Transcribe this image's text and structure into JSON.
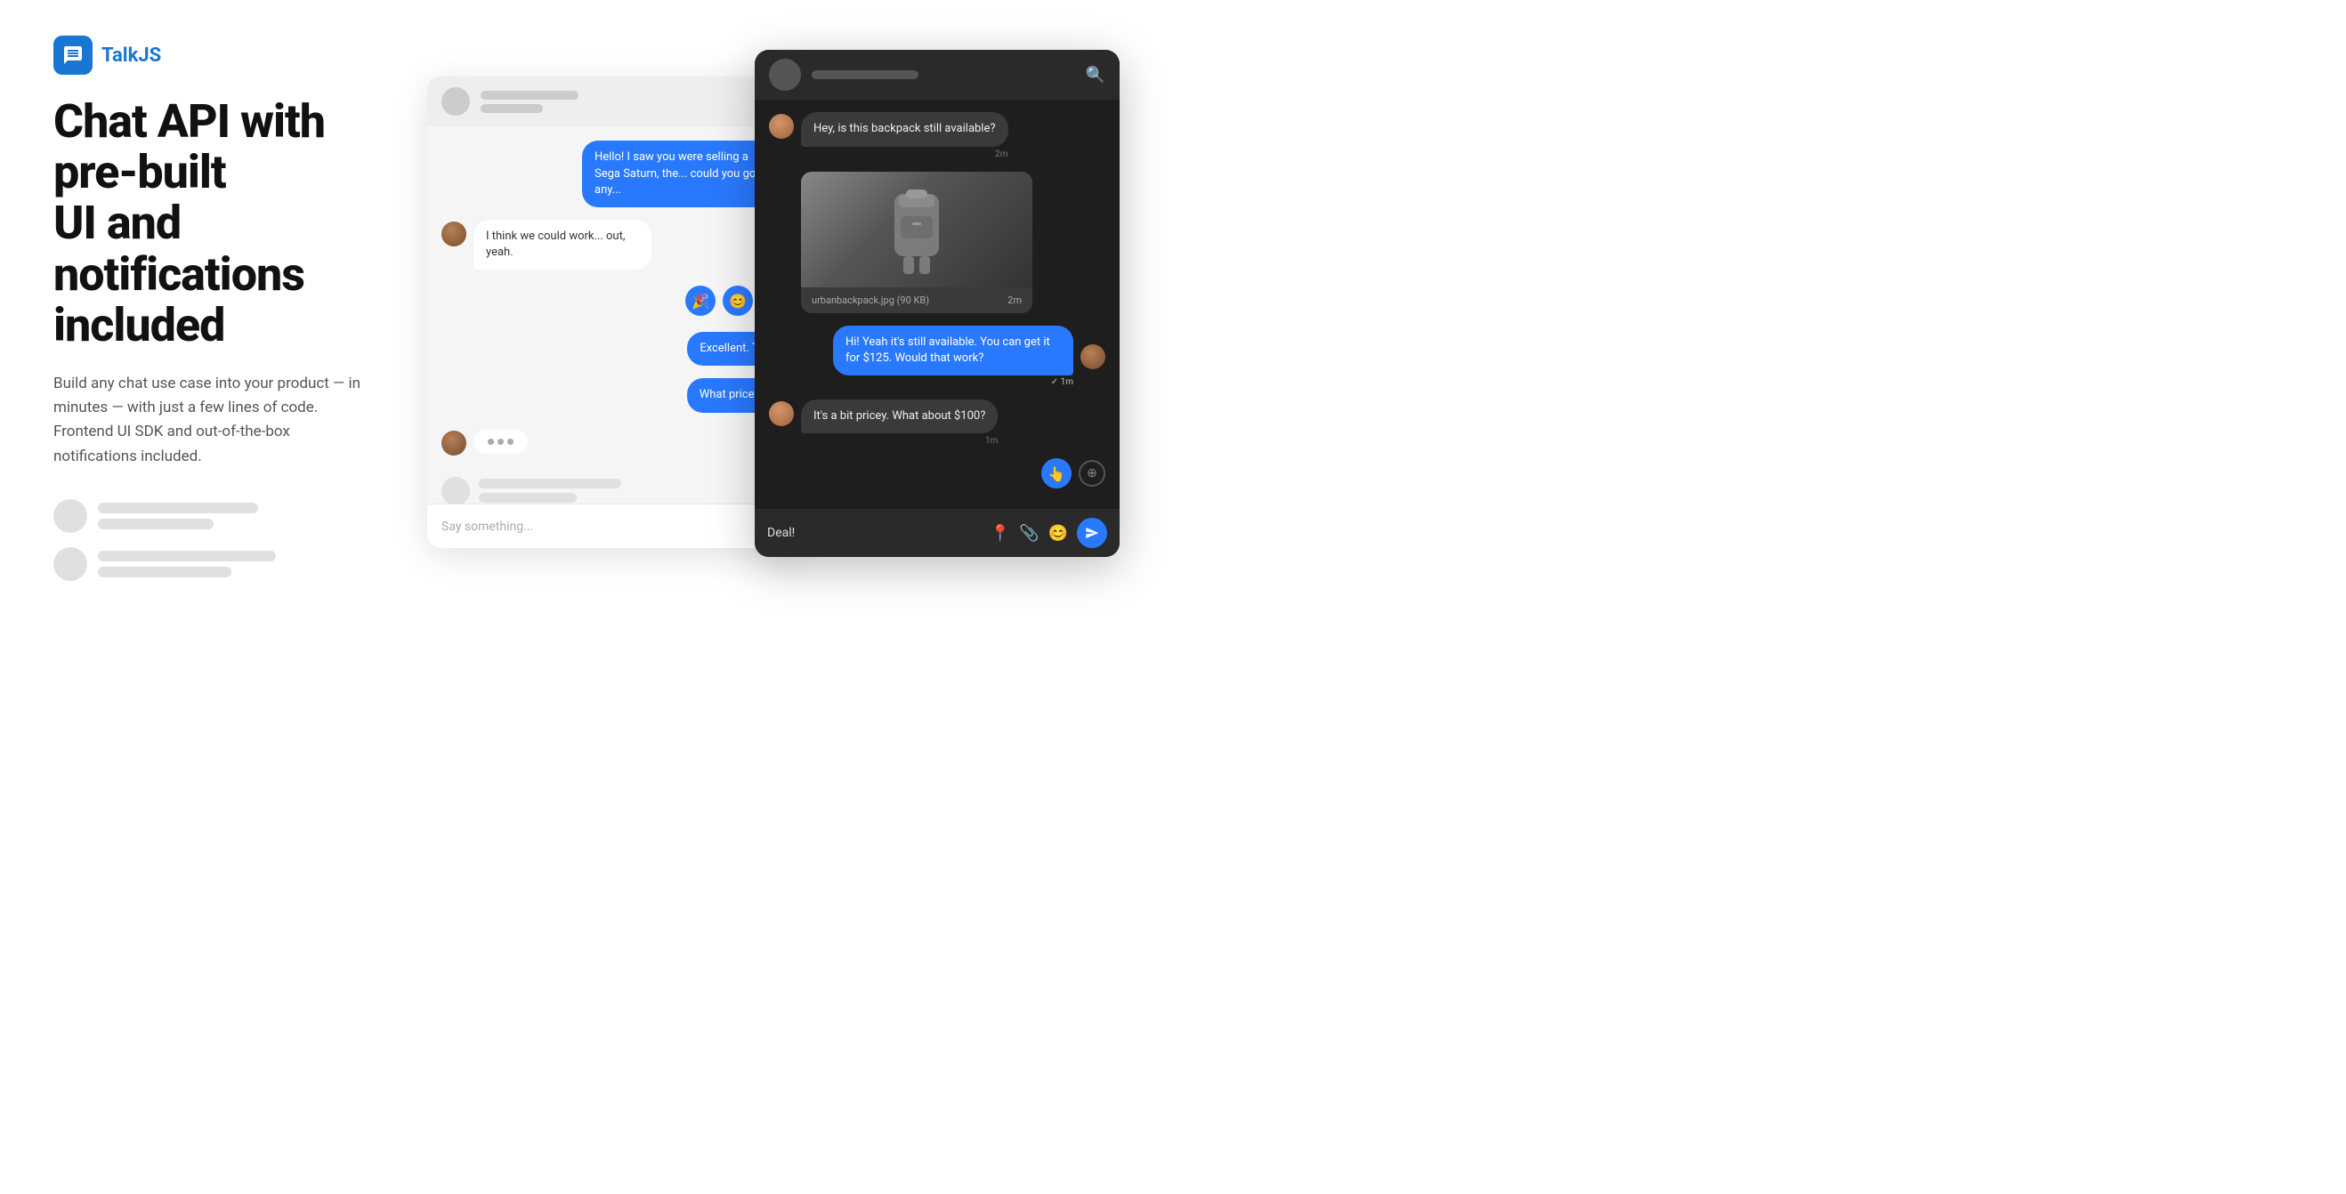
{
  "logo": {
    "icon": "💬",
    "text": "TalkJS"
  },
  "hero": {
    "headline_line1": "Chat API with pre-built",
    "headline_line2": "UI and notifications",
    "headline_line3": "included",
    "subtext": "Build any chat use case into your product — in minutes — with just a few lines of code. Frontend UI SDK and out-of-the-box notifications included."
  },
  "light_chat": {
    "input_placeholder": "Say something...",
    "msg1": "Hello! I saw you were selling a Sega Saturn, the... could you go any...",
    "msg2": "I think we could work... out, yeah.",
    "msg3": "Excellent. Th...",
    "msg4": "What price w..."
  },
  "dark_chat": {
    "search_icon": "🔍",
    "msg1": "Hey, is this backpack still available?",
    "msg1_time": "2m",
    "attachment_name": "urbanbackpack.jpg (90 KB)",
    "attachment_time": "2m",
    "msg2": "Hi! Yeah it's still available. You can get it for $125. Would that work?",
    "msg2_time": "1m",
    "msg3": "It's a bit pricey. What about $100?",
    "msg3_time": "1m",
    "footer_input": "Deal!",
    "send_icon": "▶"
  }
}
